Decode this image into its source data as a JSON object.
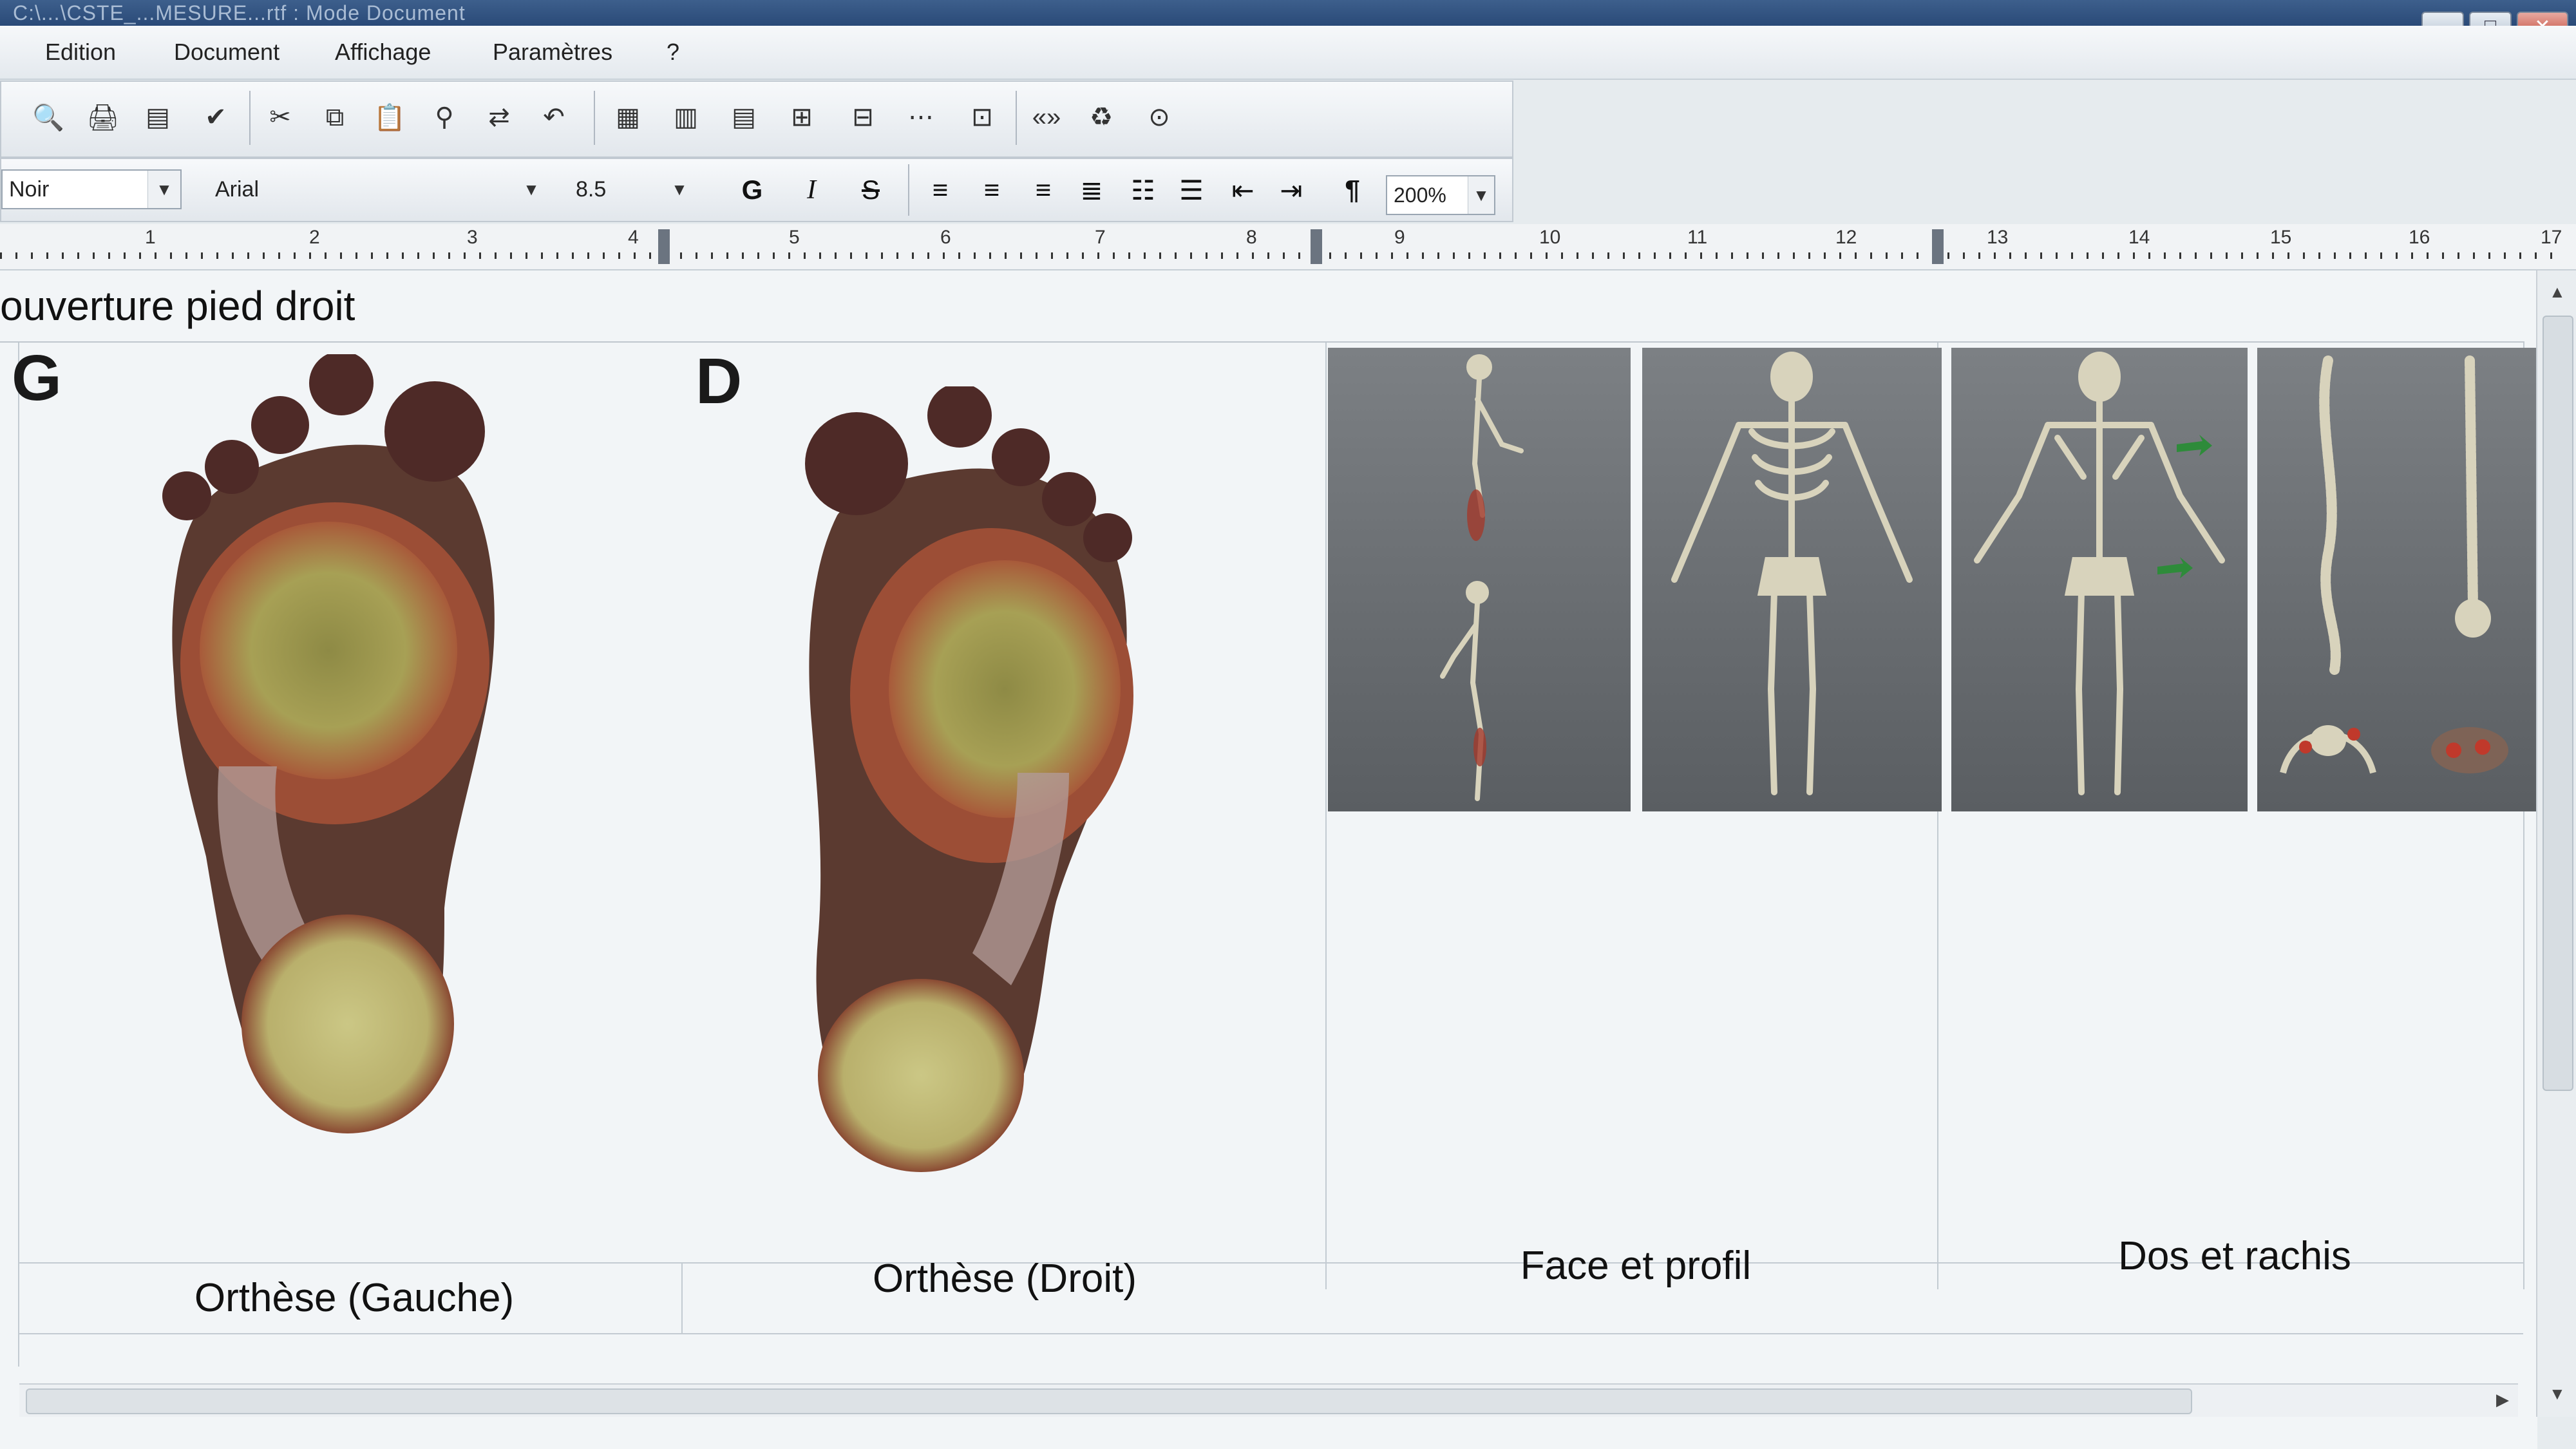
{
  "window": {
    "title": "C:\\...\\CSTE_...MESURE...rtf : Mode Document",
    "controls": {
      "minimize": "–",
      "maximize": "□",
      "close": "✕"
    }
  },
  "menu": {
    "items": [
      "Edition",
      "Document",
      "Affichage",
      "Paramètres",
      "?"
    ]
  },
  "format_bar": {
    "color_value": "Noir",
    "font_value": "Arial",
    "size_value": "8.5",
    "bold_label": "G",
    "italic_label": "I",
    "strike_label": "S",
    "pilcrow": "¶",
    "zoom_value": "200%"
  },
  "ruler": {
    "numbers": [
      "1",
      "2",
      "3",
      "4",
      "5",
      "6",
      "7",
      "8",
      "9",
      "10",
      "11",
      "12",
      "13",
      "14",
      "15",
      "16",
      "17"
    ]
  },
  "document": {
    "heading": "ouverture pied droit",
    "left_foot_letter": "G",
    "right_foot_letter": "D",
    "captions": {
      "left": "Orthèse (Gauche)",
      "right": "Orthèse (Droit)",
      "face": "Face et profil",
      "back": "Dos et rachis"
    }
  },
  "colors": {
    "panel_gray": "#6a6e72",
    "bone": "#d8d3bc",
    "pressure_high": "#c7c27a",
    "pressure_mid": "#a04a32",
    "pressure_low": "#4a2a26",
    "arrow_green": "#2e8b3a"
  }
}
